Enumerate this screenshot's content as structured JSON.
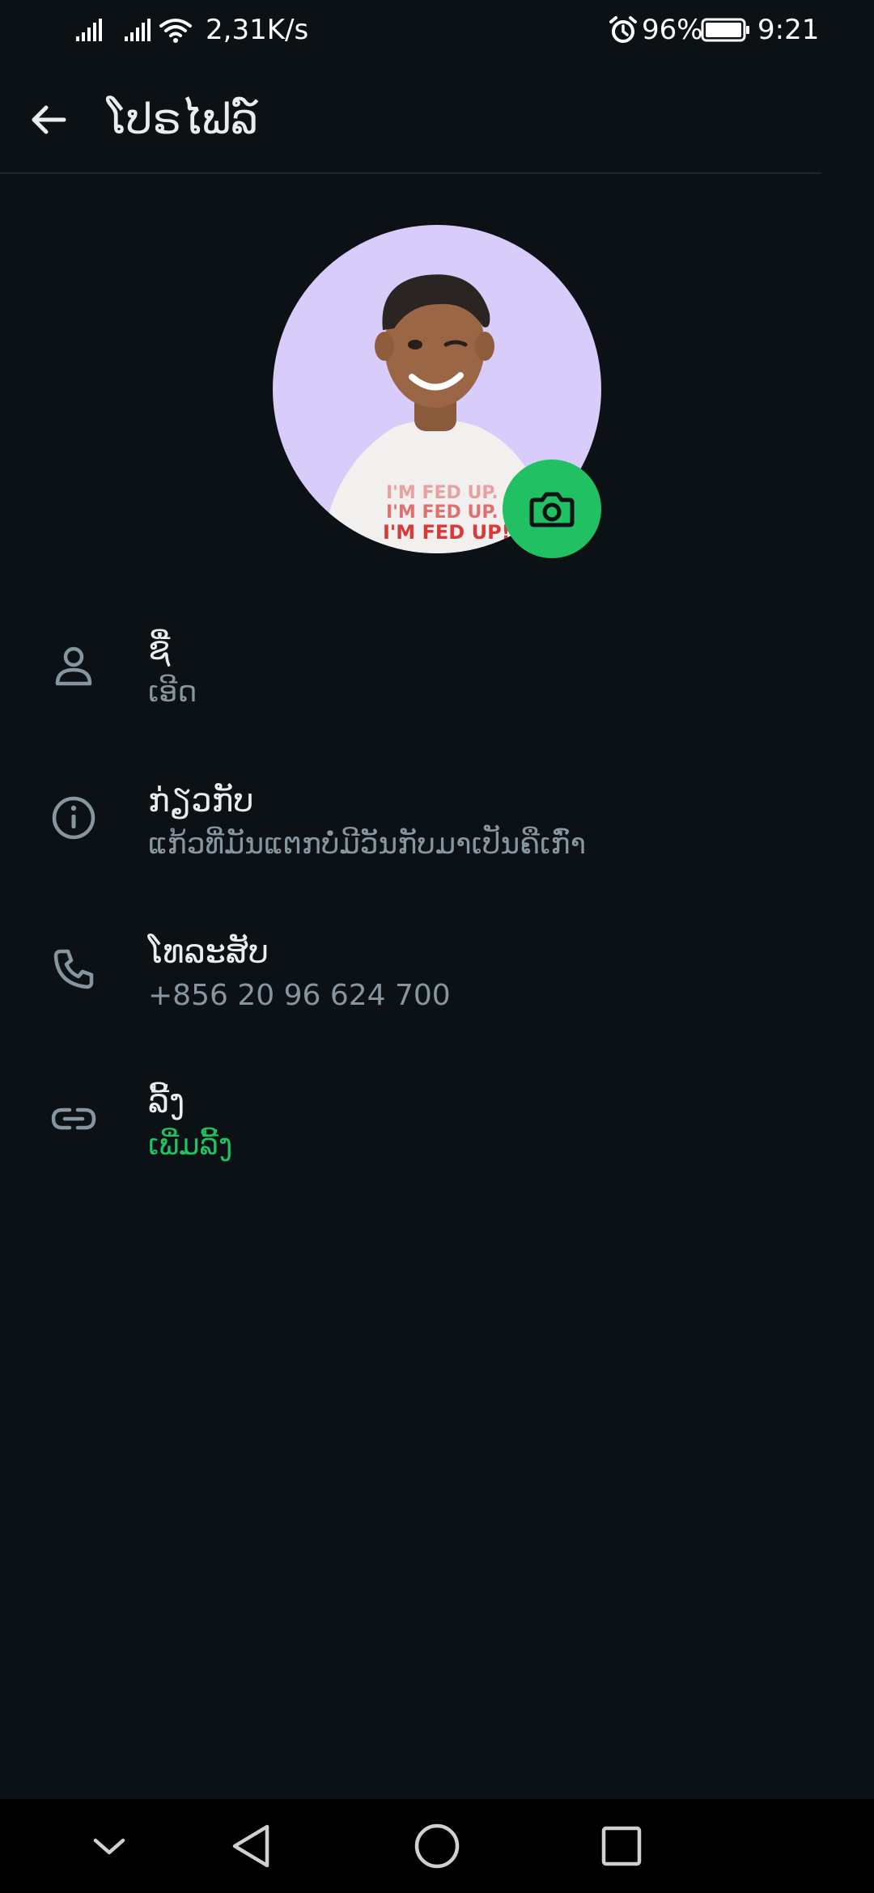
{
  "status_bar": {
    "net_speed": "2,31K/s",
    "battery_percent": "96%",
    "time": "9:21",
    "icons": [
      "signal-icon",
      "signal-icon",
      "wifi-icon",
      "alarm-icon",
      "battery-icon"
    ]
  },
  "app_bar": {
    "title": "ໂປຣໄຟລ໌",
    "back_icon": "arrow-left-icon"
  },
  "profile": {
    "avatar": "avatar-image",
    "camera_icon": "camera-icon",
    "rows": [
      {
        "icon": "person-icon",
        "label": "ຊື່",
        "value": "ເອີດ"
      },
      {
        "icon": "info-icon",
        "label": "ກ່ຽວກັບ",
        "value": "ແກ້ວທີ່ມັນແຕກບໍ່ມີວັນກັບມາເປັນຄືເກົ່າ"
      },
      {
        "icon": "phone-icon",
        "label": "ໂທລະສັບ",
        "value": "+856 20 96 624 700"
      },
      {
        "icon": "link-icon",
        "label": "ລີ້ງ",
        "value": "ເພີ່ມລີ້ງ"
      }
    ]
  },
  "colors": {
    "background": "#0b1114",
    "accent": "#21c063",
    "secondary_text": "#8696a0",
    "primary_text": "#e9edef",
    "avatar_bg": "#d8ccfb"
  },
  "nav_bar": {
    "buttons": [
      "chevron-down-icon",
      "back-triangle-icon",
      "home-circle-icon",
      "recents-square-icon"
    ]
  }
}
